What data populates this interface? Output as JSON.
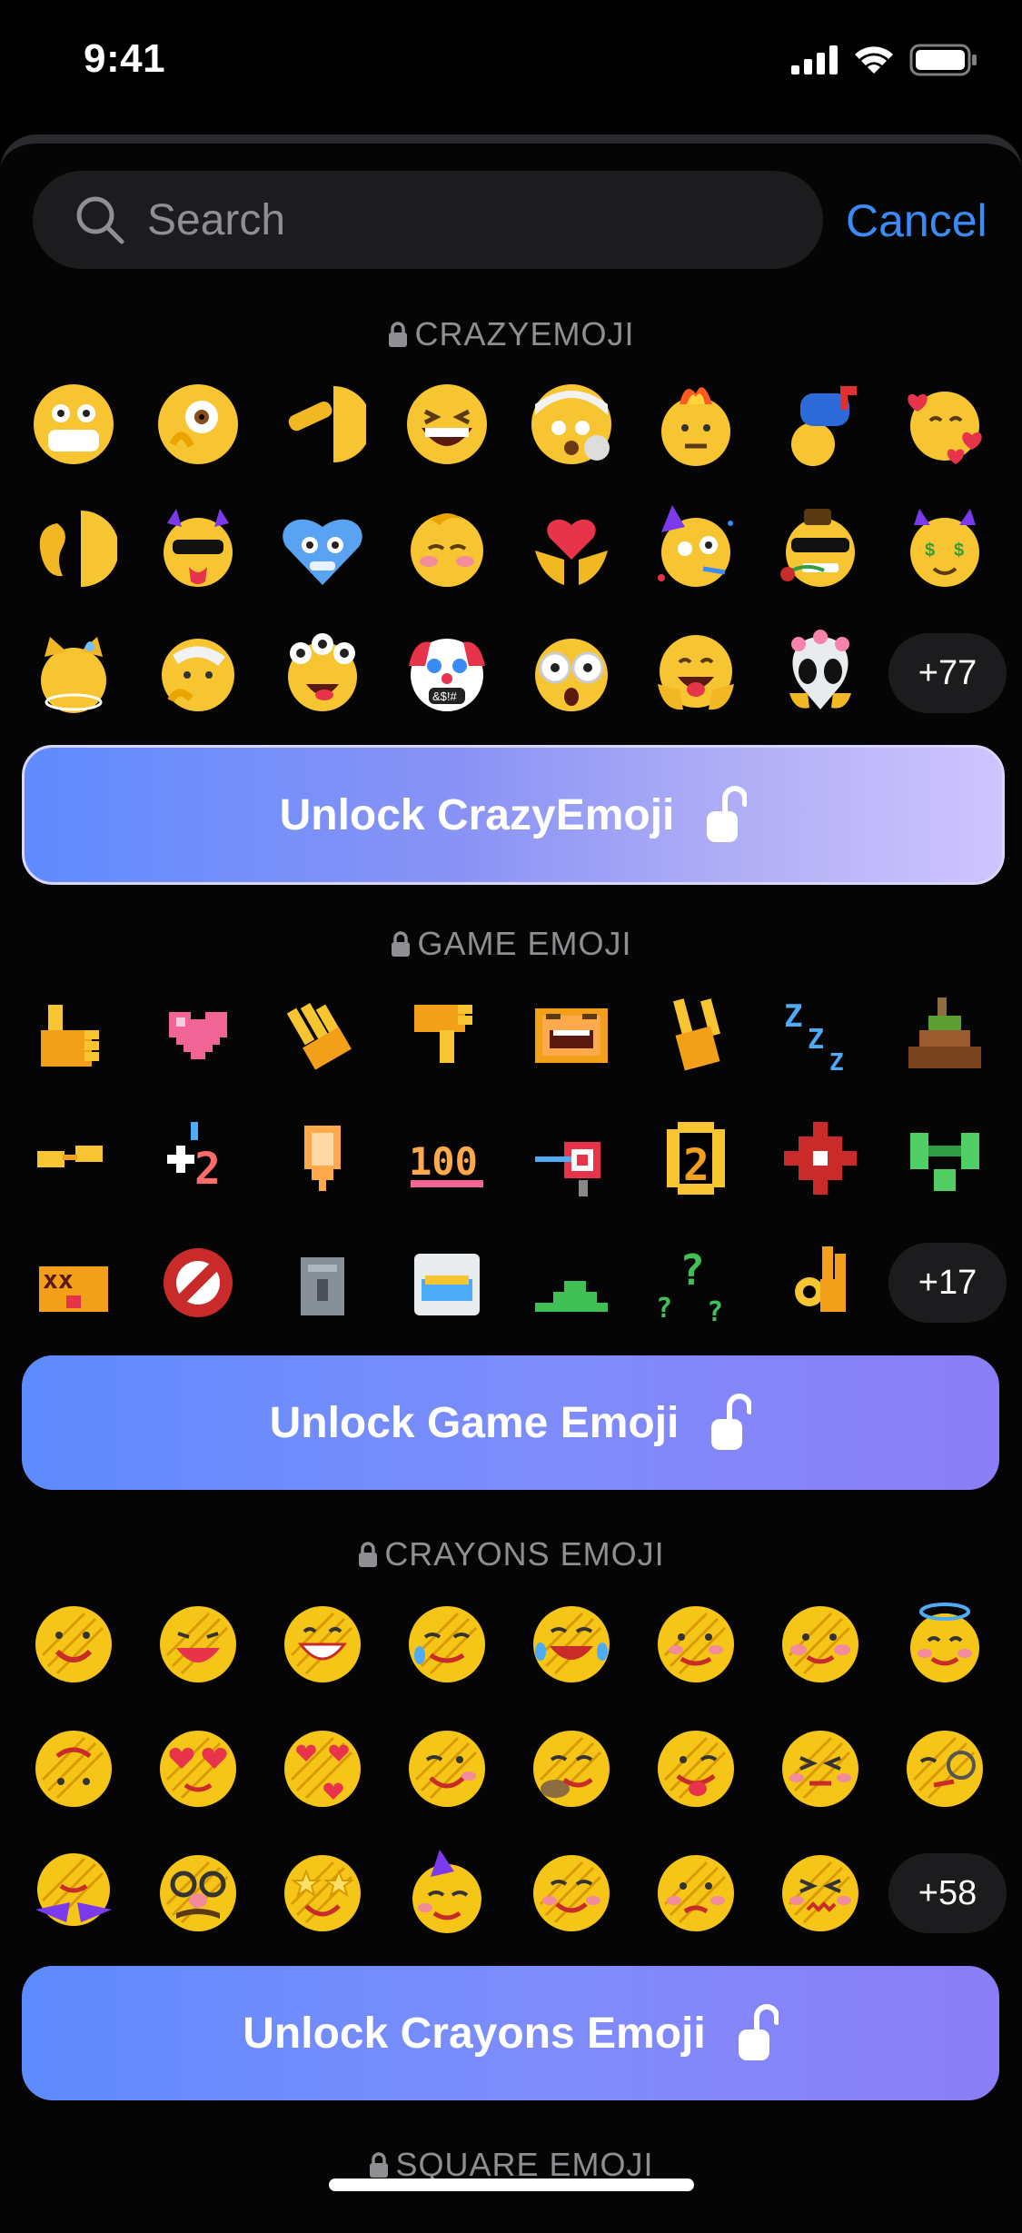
{
  "status_bar": {
    "time": "9:41"
  },
  "search": {
    "placeholder": "Search",
    "cancel_label": "Cancel"
  },
  "sections": [
    {
      "title": "CRAZYEMOJI",
      "more": "+77",
      "unlock_label": "Unlock CrazyEmoji"
    },
    {
      "title": "GAME EMOJI",
      "more": "+17",
      "unlock_label": "Unlock Game Emoji"
    },
    {
      "title": "CRAYONS EMOJI",
      "more": "+58",
      "unlock_label": "Unlock Crayons Emoji"
    },
    {
      "title": "SQUARE EMOJI"
    }
  ],
  "colors": {
    "accent": "#3a8bf5",
    "emoji_yellow": "#f7c531",
    "game_orange": "#f2a019",
    "crayon_yellow": "#f5c518"
  }
}
